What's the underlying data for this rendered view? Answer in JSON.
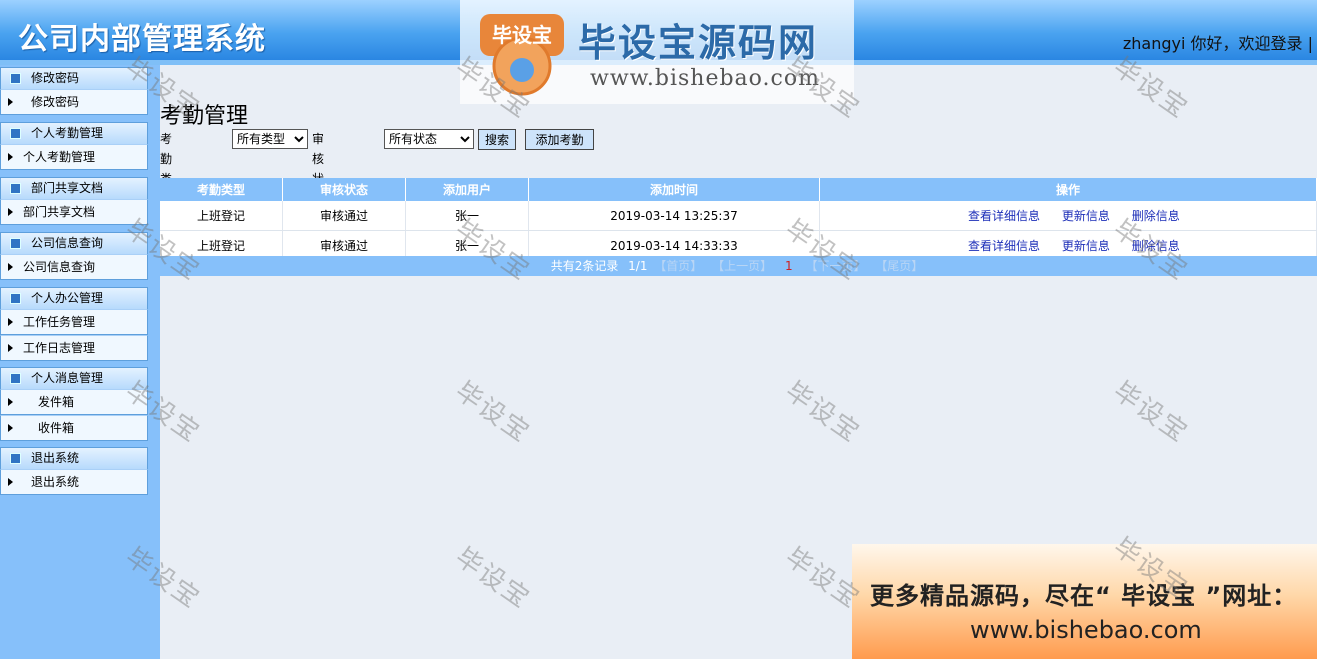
{
  "header": {
    "title": "公司内部管理系统",
    "welcome": "zhangyi 你好，欢迎登录 |"
  },
  "logo": {
    "badge": "毕设宝",
    "name": "毕设宝源码网",
    "url": "www.bishebao.com"
  },
  "sidebar": {
    "groups": [
      {
        "title": "修改密码",
        "items": [
          "修改密码"
        ]
      },
      {
        "title": "个人考勤管理",
        "items": [
          "个人考勤管理"
        ]
      },
      {
        "title": "部门共享文档",
        "items": [
          "部门共享文档"
        ]
      },
      {
        "title": "公司信息查询",
        "items": [
          "公司信息查询"
        ]
      },
      {
        "title": "个人办公管理",
        "items": [
          "工作任务管理",
          "工作日志管理"
        ]
      },
      {
        "title": "个人消息管理",
        "items": [
          "发件箱",
          "收件箱"
        ]
      },
      {
        "title": "退出系统",
        "items": [
          "退出系统"
        ]
      }
    ]
  },
  "main": {
    "page_title": "考勤管理",
    "filter": {
      "type_label": "考勤类型:",
      "type_value": "所有类型",
      "status_label": "审核状态:",
      "status_value": "所有状态",
      "search_button": "搜索",
      "add_button": "添加考勤"
    },
    "table": {
      "columns": [
        "考勤类型",
        "审核状态",
        "添加用户",
        "添加时间",
        "操作"
      ],
      "rows": [
        {
          "type": "上班登记",
          "status": "审核通过",
          "user": "张一",
          "time": "2019-03-14 13:25:37"
        },
        {
          "type": "上班登记",
          "status": "审核通过",
          "user": "张一",
          "time": "2019-03-14 14:33:33"
        }
      ],
      "ops": [
        "查看详细信息",
        "更新信息",
        "删除信息"
      ]
    },
    "pager": {
      "summary": "共有2条记录",
      "pages": "1/1",
      "first": "【首页】",
      "prev": "【上一页】",
      "current": "1",
      "next": "【下一页】",
      "last": "【尾页】"
    }
  },
  "ad": {
    "line1": "更多精品源码，尽在“ 毕设宝 ”网址：",
    "line2": "www.bishebao.com"
  },
  "watermark": "毕设宝",
  "colors": {
    "header": "#4aa3f0",
    "sidebar": "#86c0fa",
    "table_header": "#86c0fa",
    "link": "#1d2fb8",
    "current_page": "#d02020"
  }
}
